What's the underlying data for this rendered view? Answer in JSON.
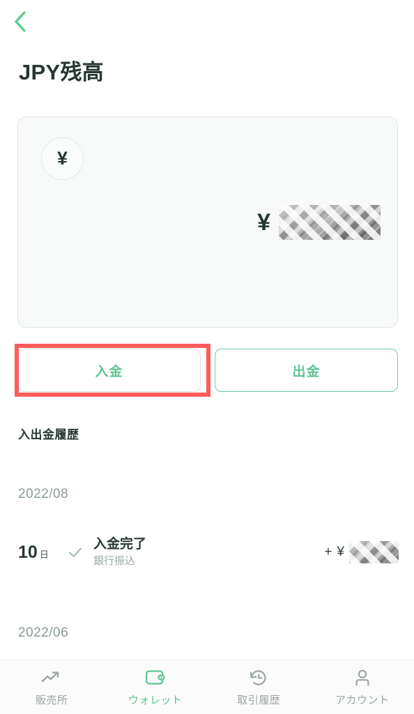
{
  "header": {
    "back_icon": "chevron-left-icon",
    "title": "JPY残高"
  },
  "balance_card": {
    "currency_badge_symbol": "¥",
    "currency_badge_icon": "yen-circle-icon",
    "balance_symbol": "¥",
    "balance_value": "[redacted]",
    "redacted": true
  },
  "actions": {
    "deposit_label": "入金",
    "withdraw_label": "出金",
    "accent_color": "#68c998",
    "highlight_color": "#fc5c5c",
    "highlighted": "入金"
  },
  "history": {
    "section_title": "入出金履歴",
    "groups": [
      {
        "month": "2022/08",
        "transactions": [
          {
            "day": "10",
            "day_unit": "日",
            "status_icon": "check-icon",
            "name": "入金完了",
            "method": "銀行振込",
            "amount_sign": "+",
            "amount_symbol": "¥",
            "amount_value": "[redacted]",
            "redacted": true
          }
        ]
      },
      {
        "month": "2022/06",
        "transactions": []
      }
    ]
  },
  "bottom_nav": {
    "items": [
      {
        "label": "販売所",
        "icon": "trending-up-icon",
        "active": false
      },
      {
        "label": "ウォレット",
        "icon": "wallet-icon",
        "active": true
      },
      {
        "label": "取引履歴",
        "icon": "clock-rewind-icon",
        "active": false
      },
      {
        "label": "アカウント",
        "icon": "person-icon",
        "active": false
      }
    ],
    "active_color": "#5ec592",
    "inactive_color": "#9aa5a1"
  }
}
